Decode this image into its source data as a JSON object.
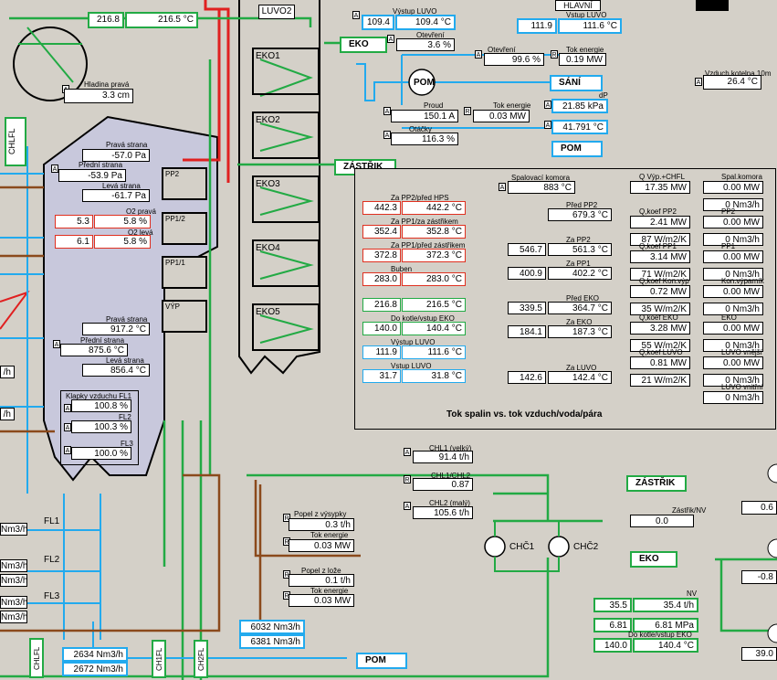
{
  "top": {
    "inlet1": "216.8",
    "inlet2": "216.5 °C",
    "luvo2": "LUVO2",
    "hlavni": "HLAVNÍ"
  },
  "luvo_out": {
    "label": "Výstup LUVO",
    "v1": "109.4",
    "v2": "109.4 °C",
    "label2": "Vstup LUVO",
    "w1": "111.9",
    "w2": "111.6 °C"
  },
  "eko_tag": "EKO",
  "opening": {
    "label": "Otevření",
    "v": "3.6 %"
  },
  "pump": {
    "otevreni_label": "Otevření",
    "otevreni": "99.6 %",
    "tok_label": "Tok energie",
    "tok": "0.19 MW",
    "pom": "POM",
    "sani": "SÁNÍ",
    "proud_label": "Proud",
    "proud": "150.1 A",
    "tok2_label": "Tok energie",
    "tok2": "0.03 MW",
    "otacky_label": "Otáčky",
    "otacky": "116.3 %",
    "dp_label": "dP",
    "dp": "21.85 kPa",
    "dp2": "41.791 °C",
    "pom2": "POM"
  },
  "kotelna": {
    "label": "Vzduch kotelna 10m",
    "v": "26.4 °C"
  },
  "hladina": {
    "label": "Hladina pravá",
    "v": "3.3 cm"
  },
  "chlfl": "CHLFL",
  "zastrik": "ZÁSTŘIK",
  "furnace": {
    "prava_label": "Pravá strana",
    "prava": "-57.0 Pa",
    "predni_label": "Přední strana",
    "predni": "-53.9 Pa",
    "leva_label": "Levá strana",
    "leva": "-61.7 Pa",
    "o2p_label": "O2 pravá",
    "o2p1": "5.3",
    "o2p2": "5.8 %",
    "o2l_label": "O2 levá",
    "o2l1": "6.1",
    "o2l2": "5.8 %",
    "t_prava_label": "Pravá strana",
    "t_prava": "917.2 °C",
    "t_predni_label": "Přední strana",
    "t_predni": "875.6 °C",
    "t_leva_label": "Levá strana",
    "t_leva": "856.4 °C",
    "fl1_label": "Klapky vzduchu FL1",
    "fl1": "100.8 %",
    "fl2_label": "FL2",
    "fl2": "100.3 %",
    "fl3_label": "FL3",
    "fl3": "100.0 %"
  },
  "heaters": [
    "PP2",
    "PP1/2",
    "PP1/1",
    "VÝP"
  ],
  "eko": [
    "EKO1",
    "EKO2",
    "EKO3",
    "EKO4",
    "EKO5"
  ],
  "panel": {
    "title": "Tok spalin vs. tok vzduch/voda/pára",
    "spal_label": "Spalovací komora",
    "spal": "883 °C",
    "rows_left": [
      {
        "label": "Za PP2/před HPS",
        "a": "442.3",
        "b": "442.2 °C"
      },
      {
        "label": "Za PP1/za zástřikem",
        "a": "352.4",
        "b": "352.8 °C"
      },
      {
        "label": "Za PP1/před zástřikem",
        "a": "372.8",
        "b": "372.3 °C"
      },
      {
        "label": "Buben",
        "a": "283.0",
        "b": "283.0 °C"
      },
      {
        "label": "",
        "a": "216.8",
        "b": "216.5 °C"
      },
      {
        "label": "Do kotle/vstup EKO",
        "a": "140.0",
        "b": "140.4 °C"
      },
      {
        "label": "Výstup LUVO",
        "a": "111.9",
        "b": "111.6 °C"
      },
      {
        "label": "Vstup LUVO",
        "a": "31.7",
        "b": "31.8 °C"
      }
    ],
    "rows_mid": [
      {
        "label": "Před PP2",
        "a": "",
        "b": "679.3 °C"
      },
      {
        "label": "Za PP2",
        "a": "546.7",
        "b": "561.3 °C"
      },
      {
        "label": "Za PP1",
        "a": "400.9",
        "b": "402.2 °C"
      },
      {
        "label": "Před EKO",
        "a": "339.5",
        "b": "364.7 °C"
      },
      {
        "label": "Za EKO",
        "a": "184.1",
        "b": "187.3 °C"
      },
      {
        "label": "Za LUVO",
        "a": "142.6",
        "b": "142.4 °C"
      }
    ],
    "rows_q": [
      {
        "label": "Q Výp.+CHFL",
        "v": "17.35 MW"
      },
      {
        "label": "Q,koef PP2",
        "v": "2.41 MW",
        "k": "87 W/m2/K"
      },
      {
        "label": "Q,koef PP1",
        "v": "3.14 MW",
        "k": "71 W/m2/K"
      },
      {
        "label": "Q,koef Kon.výp",
        "v": "0.72 MW",
        "k": "35 W/m2/K"
      },
      {
        "label": "Q,koef EKO",
        "v": "3.28 MW",
        "k": "55 W/m2/K"
      },
      {
        "label": "Q,koef LUVO",
        "v": "0.81 MW",
        "k": "21 W/m2/K"
      }
    ],
    "rows_right": [
      {
        "label": "Spal.komora",
        "v": "0.00 MW",
        "n": "0 Nm3/h"
      },
      {
        "label": "PP2",
        "v": "0.00 MW",
        "n": "0 Nm3/h"
      },
      {
        "label": "PP1",
        "v": "0.00 MW",
        "n": "0 Nm3/h"
      },
      {
        "label": "Kon.výparník",
        "v": "0.00 MW",
        "n": "0 Nm3/h"
      },
      {
        "label": "EKO",
        "v": "0.00 MW",
        "n": "0 Nm3/h"
      },
      {
        "label": "LUVO vnější",
        "v": "0.00 MW",
        "n": "0 Nm3/h"
      },
      {
        "label": "LUVO vnitřní",
        "v": "",
        "n": "0 Nm3/h"
      }
    ]
  },
  "chl": {
    "l1": "CHL1 (velký)",
    "v1": "91.4 t/h",
    "l2": "CHL1/CHL2",
    "v2": "0.87",
    "l3": "CHL2 (malý)",
    "v3": "105.6 t/h",
    "chc1": "CHČ1",
    "chc2": "CHČ2"
  },
  "popel": {
    "l1": "Popel z výsypky",
    "v1": "0.3 t/h",
    "l2": "Tok energie",
    "v2": "0.03 MW",
    "l3": "Popel z lože",
    "v3": "0.1 t/h",
    "l4": "Tok energie",
    "v4": "0.03 MW"
  },
  "right_bottom": {
    "zastrik": "ZÁSTŘIK",
    "zas_nv_label": "Zástřik/NV",
    "zas_nv": "0.0",
    "eko": "EKO",
    "nv_label": "NV",
    "nv1": "35.5",
    "nv2": "35.4 t/h",
    "p1": "6.81",
    "p2": "6.81 MPa",
    "do_kotle": "Do kotle/vstup EKO",
    "d1": "140.0",
    "d2": "140.4 °C",
    "edge1": "0.6",
    "edge2": "-0.8",
    "edge3": "39.0"
  },
  "fl_valves": [
    "FL1",
    "FL2",
    "FL3"
  ],
  "left_edge": [
    "Nm3/h",
    "Nm3/h",
    "Nm3/h",
    "Nm3/h",
    "Nm3/h",
    "Nm3/h",
    "Nm3/h",
    "/h",
    "/h"
  ],
  "bottom": {
    "flow1": "6032 Nm3/h",
    "flow2": "6381 Nm3/h",
    "flow3": "2634 Nm3/h",
    "flow4": "2672 Nm3/h",
    "pom": "POM",
    "chlfl": "CHLFL",
    "ch1fl": "CH1FL",
    "ch2fl": "CH2FL"
  }
}
